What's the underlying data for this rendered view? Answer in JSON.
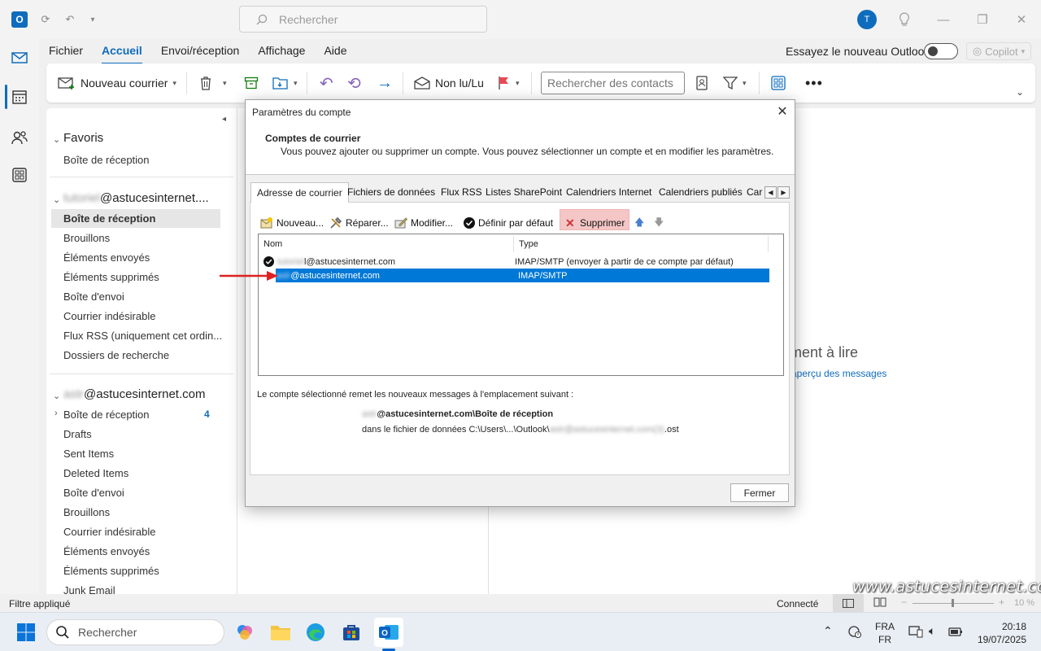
{
  "titlebar": {
    "search_placeholder": "Rechercher",
    "avatar_initial": "T"
  },
  "menu": {
    "items": [
      "Fichier",
      "Accueil",
      "Envoi/réception",
      "Affichage",
      "Aide"
    ],
    "try_new": "Essayez le nouveau Outlook",
    "copilot": "Copilot"
  },
  "ribbon": {
    "new_mail": "Nouveau courrier",
    "unread": "Non lu/Lu",
    "contact_search_placeholder": "Rechercher des contacts"
  },
  "folders": {
    "favorites": "Favoris",
    "fav_inbox": "Boîte de réception",
    "account1": "@astucesinternet....",
    "account1_blur": "tutoriel",
    "a1": [
      "Boîte de réception",
      "Brouillons",
      "Éléments envoyés",
      "Éléments supprimés",
      "Boîte d'envoi",
      "Courrier indésirable",
      "Flux RSS (uniquement cet ordin...",
      "Dossiers de recherche"
    ],
    "account2": "@astucesinternet.com",
    "account2_blur": "astr",
    "a2_inbox": "Boîte de réception",
    "a2_inbox_count": "4",
    "a2": [
      "Drafts",
      "Sent Items",
      "Deleted Items",
      "Boîte d'envoi",
      "Brouillons",
      "Courrier indésirable",
      "Éléments envoyés",
      "Éléments supprimés",
      "Junk Email"
    ]
  },
  "reading": {
    "line1": "ment à lire",
    "line2": "aperçu des messages"
  },
  "dialog": {
    "title": "Paramètres du compte",
    "header_title": "Comptes de courrier",
    "header_desc": "Vous pouvez ajouter ou supprimer un compte. Vous pouvez sélectionner un compte et en modifier les paramètres.",
    "tabs": [
      "Adresse de courrier",
      "Fichiers de données",
      "Flux RSS",
      "Listes SharePoint",
      "Calendriers Internet",
      "Calendriers publiés",
      "Car"
    ],
    "toolbar": {
      "new": "Nouveau...",
      "repair": "Réparer...",
      "modify": "Modifier...",
      "default": "Définir par défaut",
      "delete": "Supprimer"
    },
    "columns": {
      "name": "Nom",
      "type": "Type"
    },
    "accounts": [
      {
        "blur": "tutoriel",
        "name": "l@astucesinternet.com",
        "type": "IMAP/SMTP (envoyer à partir de ce compte par défaut)"
      },
      {
        "blur": "astr",
        "name": "@astucesinternet.com",
        "type": "IMAP/SMTP"
      }
    ],
    "location_label": "Le compte sélectionné remet les nouveaux messages à l'emplacement suivant :",
    "location_blur": "astr",
    "location_folder": "@astucesinternet.com\\Boîte de réception",
    "location_file_prefix": "dans le fichier de données C:\\Users\\...\\Outlook\\",
    "location_file_blur": "astr@astucesinternet.com(3)",
    "location_file_suffix": ".ost",
    "close": "Fermer"
  },
  "status": {
    "filter": "Filtre appliqué",
    "connected": "Connecté",
    "zoom": "10 %"
  },
  "taskbar": {
    "search": "Rechercher",
    "lang1": "FRA",
    "lang2": "FR",
    "time": "20:18",
    "date": "19/07/2025"
  },
  "watermark": "www.astucesinternet.com",
  "colors": {
    "accent": "#0f6cbd",
    "selection": "#0078d7",
    "delete_bg": "#f4c6c6",
    "arrow": "#e02020"
  }
}
